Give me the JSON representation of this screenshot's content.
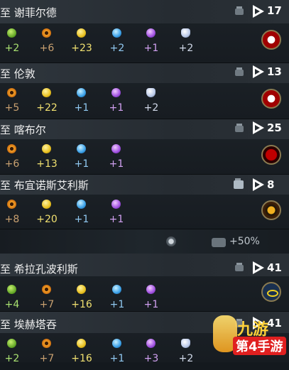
{
  "routes": [
    {
      "name": "至 谢菲尔德",
      "turns": "17",
      "civ": "england",
      "yields": [
        {
          "type": "food",
          "value": "+2"
        },
        {
          "type": "prod",
          "value": "+6"
        },
        {
          "type": "gold",
          "value": "+23"
        },
        {
          "type": "sci",
          "value": "+2"
        },
        {
          "type": "cul",
          "value": "+1"
        },
        {
          "type": "faith",
          "value": "+2"
        }
      ]
    },
    {
      "name": "至 伦敦",
      "turns": "13",
      "civ": "england",
      "yields": [
        {
          "type": "prod",
          "value": "+5"
        },
        {
          "type": "gold",
          "value": "+22"
        },
        {
          "type": "sci",
          "value": "+1"
        },
        {
          "type": "cul",
          "value": "+1"
        },
        {
          "type": "faith",
          "value": "+2"
        }
      ]
    },
    {
      "name": "至 喀布尔",
      "turns": "25",
      "civ": "aztec",
      "yields": [
        {
          "type": "prod",
          "value": "+6"
        },
        {
          "type": "gold",
          "value": "+13"
        },
        {
          "type": "sci",
          "value": "+1"
        },
        {
          "type": "cul",
          "value": "+1"
        }
      ]
    },
    {
      "name": "至 布宜诺斯艾利斯",
      "turns": "8",
      "civ": "byzantium",
      "yields": [
        {
          "type": "prod",
          "value": "+8"
        },
        {
          "type": "gold",
          "value": "+20"
        },
        {
          "type": "sci",
          "value": "+1"
        },
        {
          "type": "cul",
          "value": "+1"
        }
      ]
    },
    {
      "name": "至 希拉孔波利斯",
      "turns": "41",
      "civ": "egypt",
      "yields": [
        {
          "type": "food",
          "value": "+4"
        },
        {
          "type": "prod",
          "value": "+7"
        },
        {
          "type": "gold",
          "value": "+16"
        },
        {
          "type": "sci",
          "value": "+1"
        },
        {
          "type": "cul",
          "value": "+1"
        }
      ]
    },
    {
      "name": "至 埃赫塔吞",
      "turns": "41",
      "civ": "egypt",
      "yields": [
        {
          "type": "food",
          "value": "+2"
        },
        {
          "type": "prod",
          "value": "+7"
        },
        {
          "type": "gold",
          "value": "+16"
        },
        {
          "type": "sci",
          "value": "+1"
        },
        {
          "type": "cul",
          "value": "+3"
        },
        {
          "type": "faith",
          "value": "+2"
        }
      ]
    }
  ],
  "bonus": {
    "value": "+50%"
  },
  "watermark": {
    "top": "九游",
    "bottom": "第4手游"
  }
}
